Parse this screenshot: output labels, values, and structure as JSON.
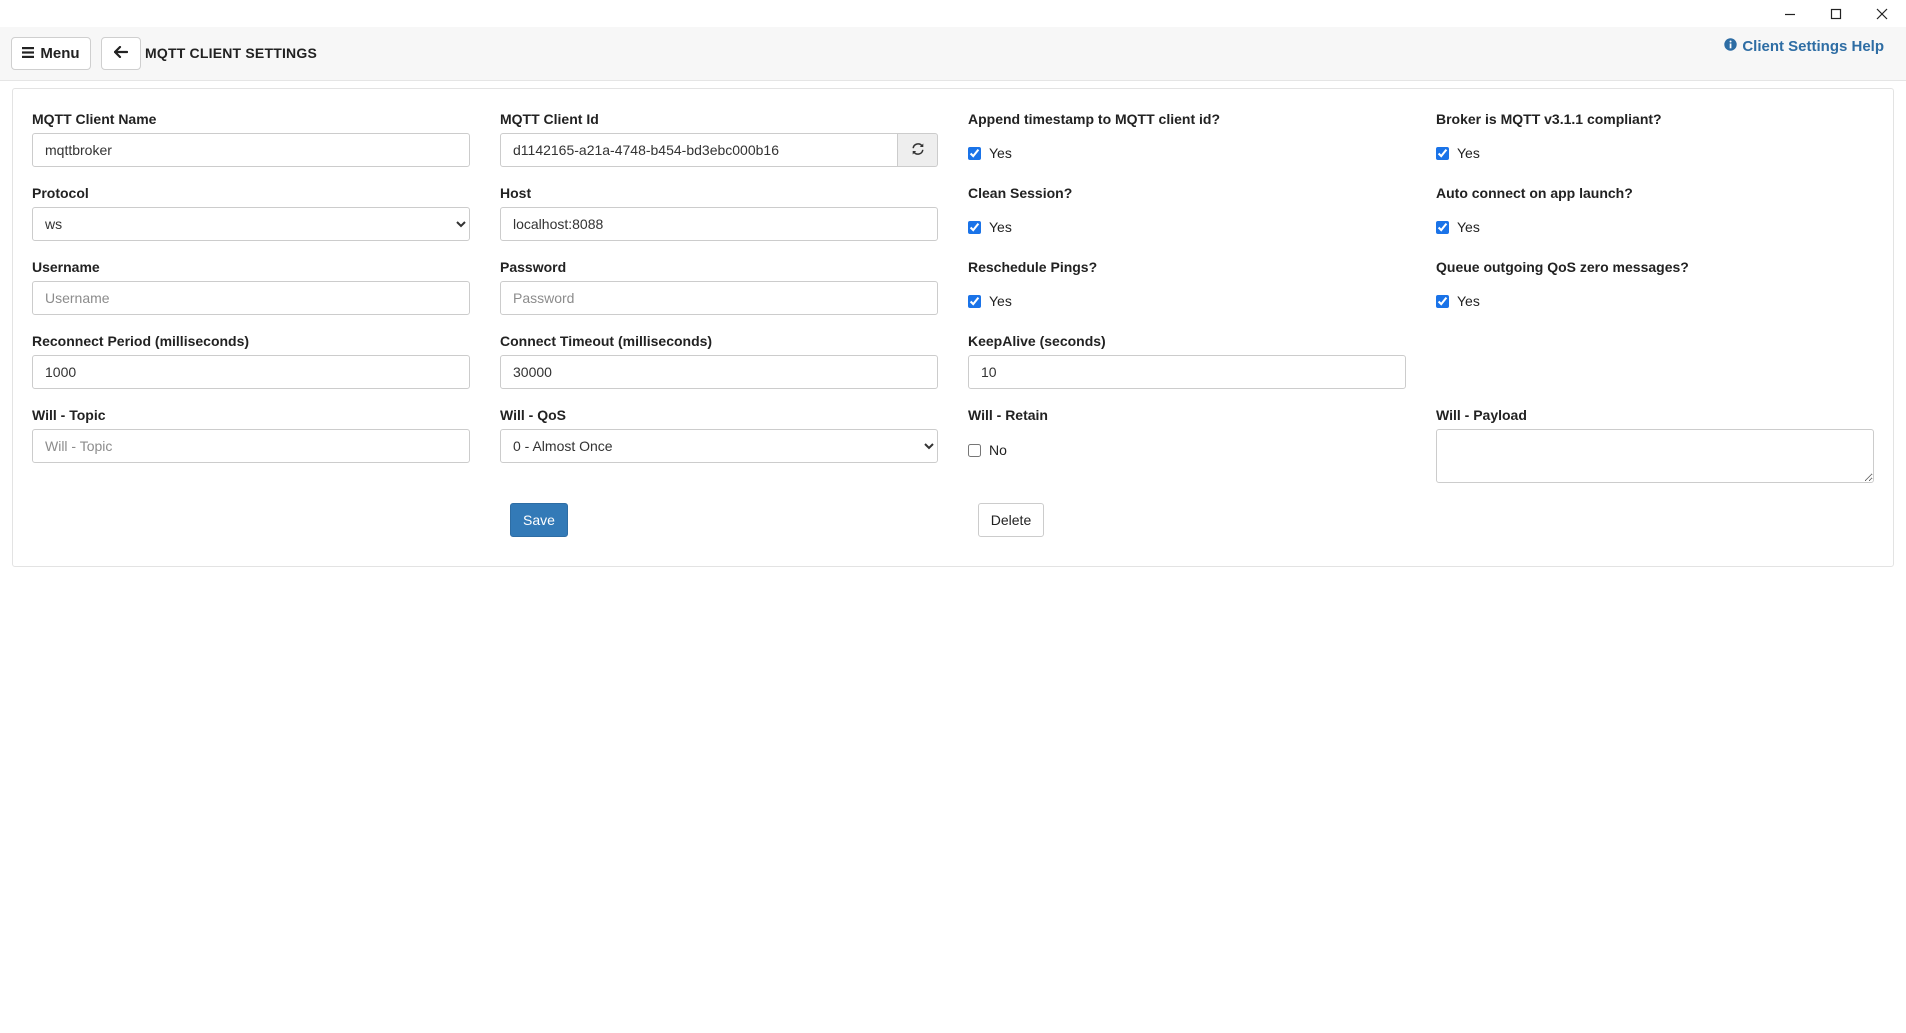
{
  "window": {
    "minimize_icon": "minimize-icon",
    "maximize_icon": "maximize-icon",
    "close_icon": "close-icon"
  },
  "header": {
    "menu_label": "Menu",
    "menu_icon": "hamburger-icon",
    "back_icon": "arrow-left-icon",
    "title": "MQTT CLIENT SETTINGS",
    "help_label": "Client Settings Help",
    "help_icon": "info-circle-icon",
    "accent_color": "#2e6da4"
  },
  "form": {
    "client_name": {
      "label": "MQTT Client Name",
      "value": "mqttbroker"
    },
    "client_id": {
      "label": "MQTT Client Id",
      "value": "d1142165-a21a-4748-b454-bd3ebc000b16",
      "refresh_icon": "refresh-icon"
    },
    "append_timestamp": {
      "label": "Append timestamp to MQTT client id?",
      "option": "Yes",
      "checked": true
    },
    "broker_compliant": {
      "label": "Broker is MQTT v3.1.1 compliant?",
      "option": "Yes",
      "checked": true
    },
    "protocol": {
      "label": "Protocol",
      "value": "ws"
    },
    "host": {
      "label": "Host",
      "value": "localhost:8088"
    },
    "clean_session": {
      "label": "Clean Session?",
      "option": "Yes",
      "checked": true
    },
    "auto_connect": {
      "label": "Auto connect on app launch?",
      "option": "Yes",
      "checked": true
    },
    "username": {
      "label": "Username",
      "value": "",
      "placeholder": "Username"
    },
    "password": {
      "label": "Password",
      "value": "",
      "placeholder": "Password"
    },
    "reschedule_pings": {
      "label": "Reschedule Pings?",
      "option": "Yes",
      "checked": true
    },
    "queue_qos_zero": {
      "label": "Queue outgoing QoS zero messages?",
      "option": "Yes",
      "checked": true
    },
    "reconnect_period": {
      "label": "Reconnect Period (milliseconds)",
      "value": "1000"
    },
    "connect_timeout": {
      "label": "Connect Timeout (milliseconds)",
      "value": "30000"
    },
    "keepalive": {
      "label": "KeepAlive (seconds)",
      "value": "10"
    },
    "will_topic": {
      "label": "Will - Topic",
      "value": "",
      "placeholder": "Will - Topic"
    },
    "will_qos": {
      "label": "Will - QoS",
      "value": "0 - Almost Once"
    },
    "will_retain": {
      "label": "Will - Retain",
      "option": "No",
      "checked": false
    },
    "will_payload": {
      "label": "Will - Payload",
      "value": ""
    }
  },
  "actions": {
    "save_label": "Save",
    "delete_label": "Delete",
    "save_color": "#337ab7"
  }
}
